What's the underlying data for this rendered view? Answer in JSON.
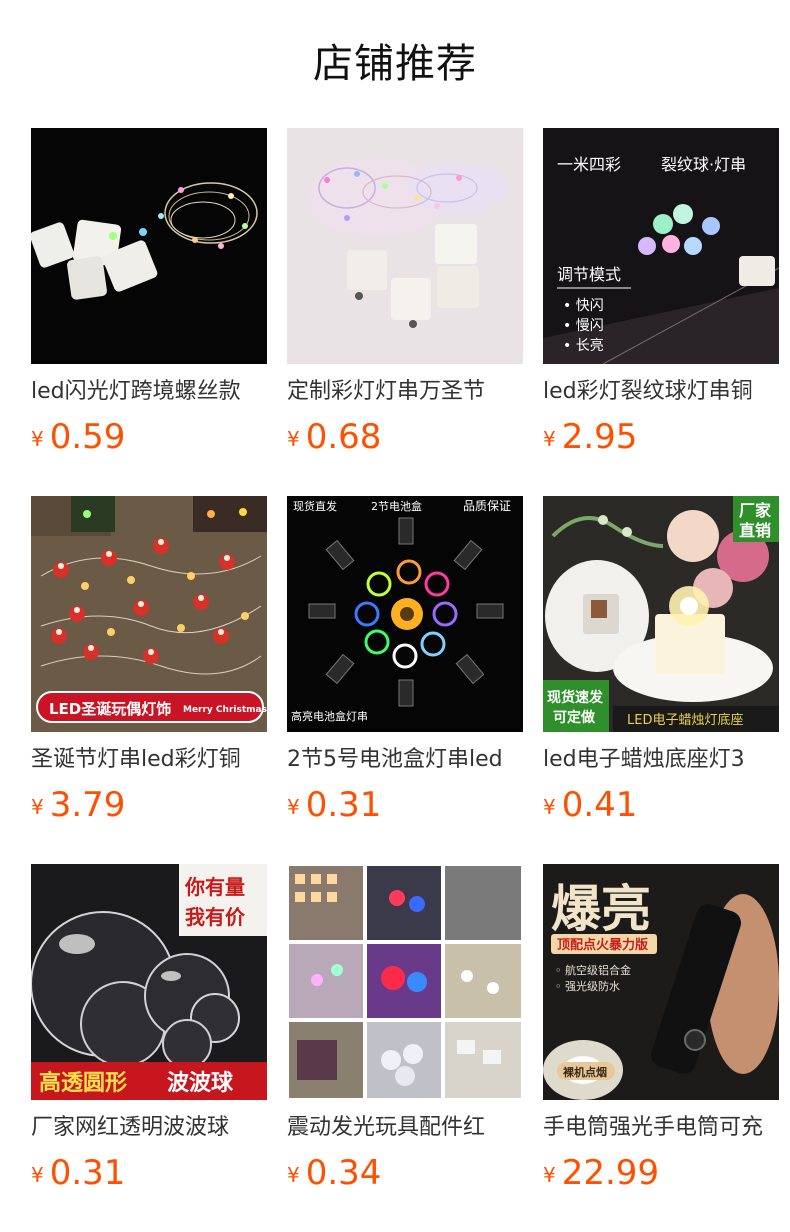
{
  "header": {
    "title": "店铺推荐"
  },
  "currency_symbol": "¥",
  "products": [
    {
      "name": "led闪光灯跨境螺丝款",
      "price": "0.59",
      "image_icon": "product-image-led-string-lights",
      "image_texts": []
    },
    {
      "name": "定制彩灯灯串万圣节",
      "price": "0.68",
      "image_icon": "product-image-colorful-string-lights",
      "image_texts": []
    },
    {
      "name": "led彩灯裂纹球灯串铜",
      "price": "2.95",
      "image_icon": "product-image-crackle-ball-lights",
      "image_texts": [
        "一米四彩",
        "裂纹球·灯串",
        "调节模式",
        "• 快闪",
        "• 慢闪",
        "• 长亮"
      ]
    },
    {
      "name": "圣诞节灯串led彩灯铜",
      "price": "3.79",
      "image_icon": "product-image-santa-string-lights",
      "image_texts": [
        "LED圣诞玩偶灯饰",
        "Merry Christmas"
      ]
    },
    {
      "name": "2节5号电池盒灯串led",
      "price": "0.31",
      "image_icon": "product-image-battery-box-lights",
      "image_texts": [
        "现货直发",
        "2节电池盒",
        "品质保证",
        "高亮电池盒灯串"
      ]
    },
    {
      "name": "led电子蜡烛底座灯3",
      "price": "0.41",
      "image_icon": "product-image-candle-base-light",
      "image_texts": [
        "厂家",
        "直销",
        "现货速发",
        "可定做",
        "LED电子蜡烛灯底座"
      ]
    },
    {
      "name": "厂家网红透明波波球",
      "price": "0.31",
      "image_icon": "product-image-bobo-balloons",
      "image_texts": [
        "你有量",
        "我有价",
        "高透圆形",
        "波波球"
      ]
    },
    {
      "name": "震动发光玩具配件红",
      "price": "0.34",
      "image_icon": "product-image-vibration-light-parts",
      "image_texts": []
    },
    {
      "name": "手电筒强光手电筒可充",
      "price": "22.99",
      "image_icon": "product-image-flashlight",
      "image_texts": [
        "爆亮",
        "顶配点火暴力版",
        "◦ 航空级铝合金",
        "◦ 强光级防水",
        "裸机点烟"
      ]
    }
  ]
}
